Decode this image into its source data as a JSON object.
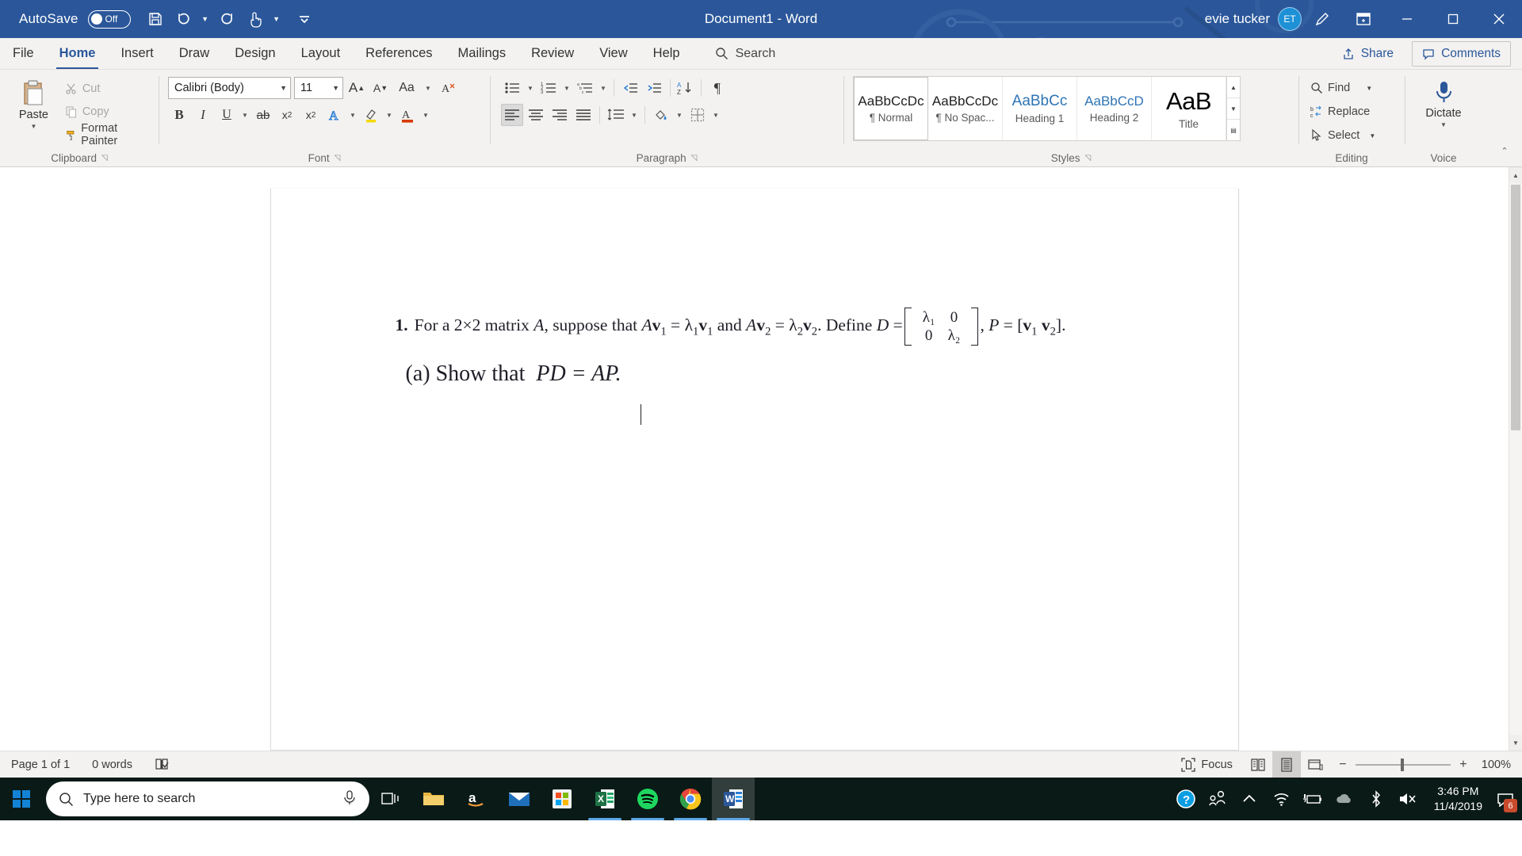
{
  "titlebar": {
    "autosave_label": "AutoSave",
    "autosave_state": "Off",
    "document_title": "Document1  -  Word",
    "user_name": "evie tucker",
    "avatar_initials": "ET",
    "qat": [
      {
        "name": "save-button",
        "icon": "save-icon"
      },
      {
        "name": "undo-button",
        "icon": "undo-icon"
      },
      {
        "name": "redo-button",
        "icon": "redo-icon"
      },
      {
        "name": "touch-mode-button",
        "icon": "touch-pointer-icon"
      },
      {
        "name": "customize-quick-access-toolbar-button",
        "icon": "chevron-down-icon"
      }
    ],
    "window_buttons": [
      "minimize",
      "restore",
      "close"
    ],
    "brand_color": "#2b579a"
  },
  "tabs": [
    {
      "label": "File",
      "active": false
    },
    {
      "label": "Home",
      "active": true
    },
    {
      "label": "Insert",
      "active": false
    },
    {
      "label": "Draw",
      "active": false
    },
    {
      "label": "Design",
      "active": false
    },
    {
      "label": "Layout",
      "active": false
    },
    {
      "label": "References",
      "active": false
    },
    {
      "label": "Mailings",
      "active": false
    },
    {
      "label": "Review",
      "active": false
    },
    {
      "label": "View",
      "active": false
    },
    {
      "label": "Help",
      "active": false
    }
  ],
  "search": {
    "placeholder": "Search",
    "label": "Search"
  },
  "tabbar_actions": [
    {
      "label": "Share",
      "icon": "share-icon"
    },
    {
      "label": "Comments",
      "icon": "comment-icon"
    }
  ],
  "ribbon": {
    "clipboard": {
      "group_label": "Clipboard",
      "paste_label": "Paste",
      "items": [
        {
          "label": "Cut",
          "icon": "scissors-icon",
          "disabled": true
        },
        {
          "label": "Copy",
          "icon": "copy-icon",
          "disabled": true
        },
        {
          "label": "Format Painter",
          "icon": "format-painter-icon",
          "disabled": false
        }
      ]
    },
    "font": {
      "group_label": "Font",
      "font_name": "Calibri (Body)",
      "font_size": "11",
      "grow_label": "A",
      "shrink_label": "A",
      "change_case_label": "Aa",
      "clear_formatting_label": "A",
      "buttons": [
        "Bold",
        "Italic",
        "Underline",
        "Strikethrough",
        "Subscript",
        "Superscript",
        "Text Effects",
        "Text Highlight Color",
        "Font Color"
      ]
    },
    "paragraph": {
      "group_label": "Paragraph",
      "buttons": [
        "Bullets",
        "Numbering",
        "Multilevel List",
        "Decrease Indent",
        "Increase Indent",
        "Sort",
        "Show/Hide",
        "Align Left",
        "Center",
        "Align Right",
        "Justify",
        "Line and Paragraph Spacing",
        "Shading",
        "Borders"
      ]
    },
    "styles": {
      "group_label": "Styles",
      "items": [
        {
          "preview": "AaBbCcDc",
          "name": "¶ Normal",
          "kind": "normal",
          "selected": true
        },
        {
          "preview": "AaBbCcDc",
          "name": "¶ No Spac...",
          "kind": "nospacing",
          "selected": false
        },
        {
          "preview": "AaBbCс",
          "name": "Heading 1",
          "kind": "h1",
          "selected": false
        },
        {
          "preview": "AaBbCcD",
          "name": "Heading 2",
          "kind": "h2",
          "selected": false
        },
        {
          "preview": "AaB",
          "name": "Title",
          "kind": "title",
          "selected": false
        }
      ]
    },
    "editing": {
      "group_label": "Editing",
      "items": [
        {
          "label": "Find",
          "icon": "search-icon",
          "has_caret": true
        },
        {
          "label": "Replace",
          "icon": "replace-icon",
          "has_caret": false
        },
        {
          "label": "Select",
          "icon": "select-icon",
          "has_caret": true
        }
      ]
    },
    "voice": {
      "group_label": "Voice",
      "dictate_label": "Dictate",
      "icon": "microphone-icon"
    },
    "collapse_ribbon_icon": "chevron-up-icon"
  },
  "document": {
    "question_number": "1.",
    "question_text_1": "For a 2×2 matrix ",
    "var_A": "A",
    "question_text_2": ", suppose that ",
    "eq1_lhs_A": "A",
    "eq1_lhs_v": "v",
    "eq1_lhs_v_sub": "1",
    "eq1_eq": "=",
    "eq1_rhs_lambda": "λ",
    "eq1_rhs_lambda_sub": "1",
    "eq1_rhs_v": "v",
    "eq1_rhs_v_sub": "1",
    "conjunction": " and ",
    "eq2_lhs_A": "A",
    "eq2_lhs_v": "v",
    "eq2_lhs_v_sub": "2",
    "eq2_eq": "=",
    "eq2_rhs_lambda": "λ",
    "eq2_rhs_lambda_sub": "2",
    "eq2_rhs_v": "v",
    "eq2_rhs_v_sub": "2",
    "define_text": ". Define ",
    "var_D": "D",
    "equals": "=",
    "matrix_D": [
      [
        "λ₁",
        "0"
      ],
      [
        "0",
        "λ₂"
      ]
    ],
    "comma": ", ",
    "var_P": "P",
    "matrix_P_open": "[",
    "matrix_P_v1": "v",
    "matrix_P_v1_sub": "1",
    "matrix_P_v2": "v",
    "matrix_P_v2_sub": "2",
    "matrix_P_close": "]",
    "period": ".",
    "part_a_label": "(a)",
    "part_a_text": "Show that",
    "part_a_equation": "PD = AP."
  },
  "statusbar": {
    "page_info": "Page 1 of 1",
    "word_count": "0 words",
    "proofing_icon": "proofing-errors-icon",
    "focus_label": "Focus",
    "focus_icon": "focus-icon",
    "views": [
      {
        "name": "read-mode",
        "icon": "read-mode-icon",
        "active": false
      },
      {
        "name": "print-layout",
        "icon": "print-layout-icon",
        "active": true
      },
      {
        "name": "web-layout",
        "icon": "web-layout-icon",
        "active": false
      }
    ],
    "zoom_out": "−",
    "zoom_in": "+",
    "zoom_percent": "100%"
  },
  "taskbar": {
    "start_icon": "windows-start-icon",
    "search_placeholder": "Type here to search",
    "search_icon": "search-icon",
    "cortana_icon": "cortana-mic-icon",
    "task_view_icon": "task-view-icon",
    "apps": [
      {
        "name": "file-explorer",
        "icon": "folder-icon",
        "running": false,
        "active": false
      },
      {
        "name": "amazon",
        "icon": "amazon-icon",
        "running": false,
        "active": false
      },
      {
        "name": "mail",
        "icon": "mail-icon",
        "running": false,
        "active": false
      },
      {
        "name": "microsoft-store",
        "icon": "store-icon",
        "running": false,
        "active": false
      },
      {
        "name": "excel",
        "icon": "excel-icon",
        "running": true,
        "active": false
      },
      {
        "name": "spotify",
        "icon": "spotify-icon",
        "running": true,
        "active": false
      },
      {
        "name": "chrome",
        "icon": "chrome-icon",
        "running": true,
        "active": false
      },
      {
        "name": "word",
        "icon": "word-icon",
        "running": true,
        "active": true
      }
    ],
    "tray": [
      {
        "name": "help-support",
        "icon": "question-circle-icon"
      },
      {
        "name": "people",
        "icon": "people-icon"
      },
      {
        "name": "show-hidden-icons",
        "icon": "chevron-up-icon"
      },
      {
        "name": "network",
        "icon": "wifi-icon"
      },
      {
        "name": "battery",
        "icon": "battery-charging-icon"
      },
      {
        "name": "onedrive",
        "icon": "cloud-icon"
      },
      {
        "name": "bluetooth",
        "icon": "bluetooth-icon"
      },
      {
        "name": "volume",
        "icon": "speaker-mute-icon"
      }
    ],
    "time": "3:46 PM",
    "date": "11/4/2019",
    "notification_count": "6",
    "notification_icon": "action-center-icon"
  }
}
